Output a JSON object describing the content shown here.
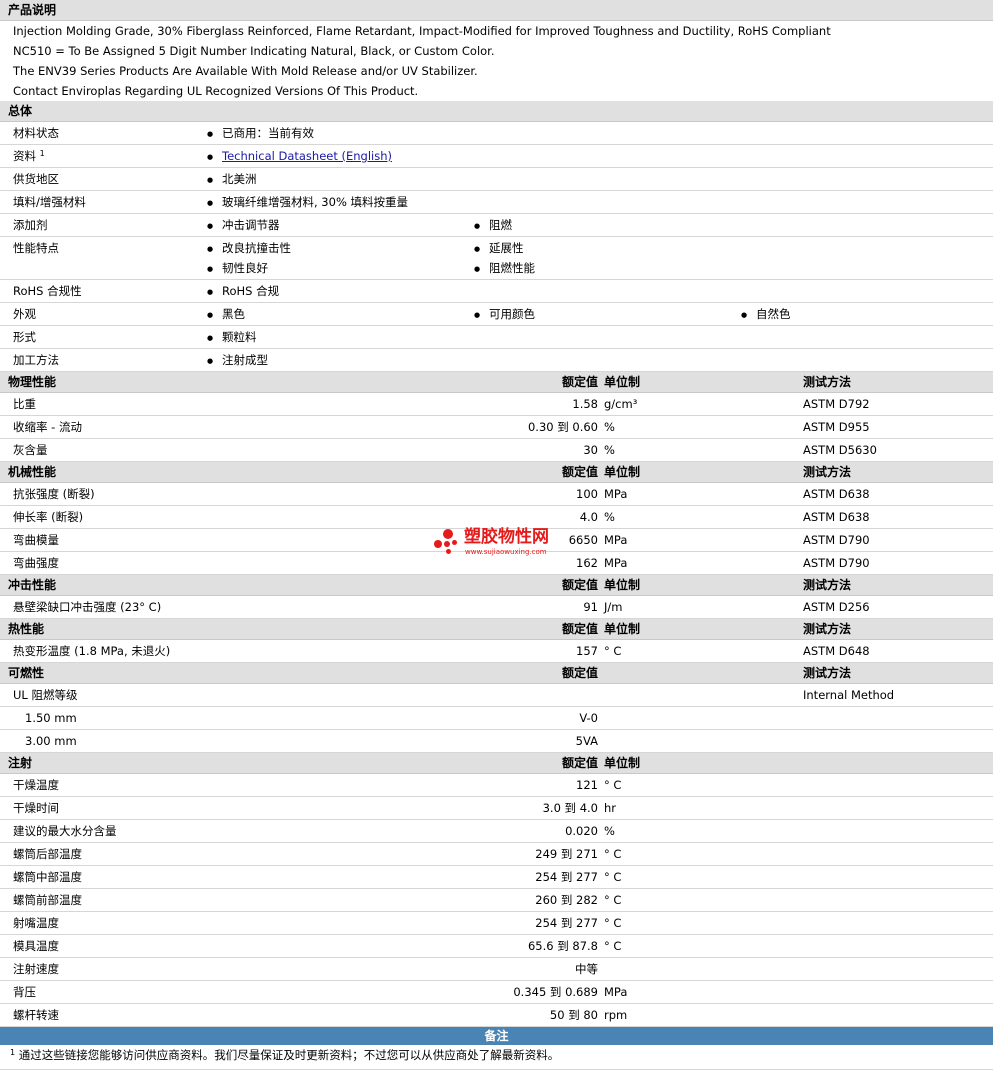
{
  "description": {
    "title": "产品说明",
    "lines": [
      "Injection Molding Grade, 30% Fiberglass Reinforced, Flame Retardant, Impact-Modified for Improved Toughness and Ductility, RoHS Compliant",
      "NC510 = To Be Assigned 5 Digit Number Indicating Natural, Black, or Custom Color.",
      "The ENV39 Series Products Are Available With Mold Release and/or UV Stabilizer.",
      "Contact Enviroplas Regarding UL Recognized Versions Of This Product."
    ]
  },
  "general": {
    "title": "总体",
    "rows": [
      {
        "label": "材料状态",
        "items": [
          "已商用：当前有效"
        ]
      },
      {
        "label": "资料",
        "sup": "1",
        "link": "Technical Datasheet (English)"
      },
      {
        "label": "供货地区",
        "items": [
          "北美洲"
        ]
      },
      {
        "label": "填料/增强材料",
        "items": [
          "玻璃纤维增强材料, 30% 填料按重量"
        ]
      },
      {
        "label": "添加剂",
        "items": [
          "冲击调节器",
          "阻燃"
        ]
      },
      {
        "label": "性能特点",
        "items": [
          "改良抗撞击性",
          "延展性",
          "韧性良好",
          "阻燃性能"
        ]
      },
      {
        "label": "RoHS 合规性",
        "items": [
          "RoHS 合规"
        ]
      },
      {
        "label": "外观",
        "items": [
          "黑色",
          "可用颜色",
          "自然色"
        ]
      },
      {
        "label": "形式",
        "items": [
          "颗粒料"
        ]
      },
      {
        "label": "加工方法",
        "items": [
          "注射成型"
        ]
      }
    ]
  },
  "col_labels": {
    "value": "额定值",
    "unit": "单位制",
    "method": "测试方法"
  },
  "physical": {
    "title": "物理性能",
    "rows": [
      {
        "label": "比重",
        "value": "1.58",
        "unit": "g/cm³",
        "method": "ASTM D792"
      },
      {
        "label": "收缩率 - 流动",
        "value": "0.30 到  0.60",
        "unit": "%",
        "method": "ASTM D955"
      },
      {
        "label": "灰含量",
        "value": "30",
        "unit": "%",
        "method": "ASTM D5630"
      }
    ]
  },
  "mechanical": {
    "title": "机械性能",
    "rows": [
      {
        "label": "抗张强度 (断裂)",
        "value": "100",
        "unit": "MPa",
        "method": "ASTM D638"
      },
      {
        "label": "伸长率 (断裂)",
        "value": "4.0",
        "unit": "%",
        "method": "ASTM D638"
      },
      {
        "label": "弯曲模量",
        "value": "6650",
        "unit": "MPa",
        "method": "ASTM D790"
      },
      {
        "label": "弯曲强度",
        "value": "162",
        "unit": "MPa",
        "method": "ASTM D790"
      }
    ]
  },
  "impact": {
    "title": "冲击性能",
    "rows": [
      {
        "label": "悬壁梁缺口冲击强度 (23° C)",
        "value": "91",
        "unit": "J/m",
        "method": "ASTM D256"
      }
    ]
  },
  "thermal": {
    "title": "热性能",
    "rows": [
      {
        "label": "热变形温度 (1.8 MPa, 未退火)",
        "value": "157",
        "unit": "° C",
        "method": "ASTM D648"
      }
    ]
  },
  "flammability": {
    "title": "可燃性",
    "rows": [
      {
        "label": "UL 阻燃等级",
        "value": "",
        "unit": "",
        "method": "Internal Method"
      },
      {
        "label": "1.50 mm",
        "value": "V-0",
        "unit": "",
        "method": ""
      },
      {
        "label": "3.00 mm",
        "value": "5VA",
        "unit": "",
        "method": ""
      }
    ]
  },
  "injection": {
    "title": "注射",
    "rows": [
      {
        "label": "干燥温度",
        "value": "121",
        "unit": "° C"
      },
      {
        "label": "干燥时间",
        "value": "3.0 到  4.0",
        "unit": "hr"
      },
      {
        "label": "建议的最大水分含量",
        "value": "0.020",
        "unit": "%"
      },
      {
        "label": "螺筒后部温度",
        "value": "249 到  271",
        "unit": "° C"
      },
      {
        "label": "螺筒中部温度",
        "value": "254 到  277",
        "unit": "° C"
      },
      {
        "label": "螺筒前部温度",
        "value": "260 到  282",
        "unit": "° C"
      },
      {
        "label": "射嘴温度",
        "value": "254 到  277",
        "unit": "° C"
      },
      {
        "label": "模具温度",
        "value": "65.6 到  87.8",
        "unit": "° C"
      },
      {
        "label": "注射速度",
        "value": "中等",
        "unit": ""
      },
      {
        "label": "背压",
        "value": "0.345 到  0.689",
        "unit": "MPa"
      },
      {
        "label": "螺杆转速",
        "value": "50 到  80",
        "unit": "rpm"
      }
    ]
  },
  "notes": {
    "title": "备注",
    "sup": "1",
    "text": "通过这些链接您能够访问供应商资料。我们尽量保证及时更新资料；不过您可以从供应商处了解最新资料。"
  },
  "watermark": {
    "main": "塑胶物性网",
    "sub": "www.sujiaowuxing.com",
    "color": "#e51b1b"
  }
}
